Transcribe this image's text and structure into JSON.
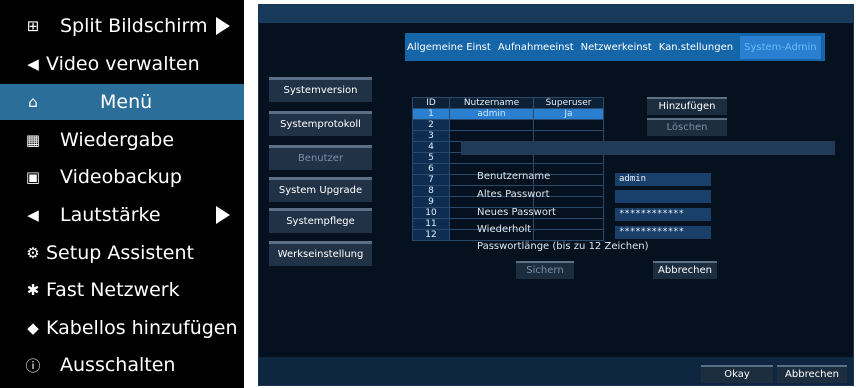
{
  "menu": {
    "items": [
      {
        "icon": "⊞",
        "label": "Split Bildschirm",
        "arrow": true
      },
      {
        "icon": "◀",
        "label": "Video verwalten",
        "arrow": false
      },
      {
        "icon": "⌂",
        "label": "Menü",
        "arrow": false,
        "selected": true
      },
      {
        "icon": "▦",
        "label": "Wiedergabe",
        "arrow": false
      },
      {
        "icon": "▣",
        "label": "Videobackup",
        "arrow": false
      },
      {
        "icon": "◀",
        "label": "Lautstärke",
        "arrow": true
      },
      {
        "icon": "⚙",
        "label": "Setup Assistent",
        "arrow": false
      },
      {
        "icon": "✱",
        "label": "Fast Netzwerk",
        "arrow": false
      },
      {
        "icon": "◆",
        "label": "Kabellos hinzufügen",
        "arrow": false
      },
      {
        "icon": "ⓘ",
        "label": "Ausschalten",
        "arrow": false
      }
    ]
  },
  "dialog": {
    "tabs": [
      "Allgemeine Einst",
      "Aufnahmeeinst",
      "Netzwerkeinst",
      "Kan.stellungen",
      "System-Admin"
    ],
    "active_tab": "System-Admin",
    "sidebar": [
      "Systemversion",
      "Systemprotokoll",
      "Benutzer",
      "System Upgrade",
      "Systempflege",
      "Werkseinstellung"
    ],
    "active_sidebar": "Benutzer",
    "table": {
      "headers": [
        "ID",
        "Nutzername",
        "Superuser"
      ],
      "rows": [
        {
          "id": "1",
          "name": "admin",
          "superuser": "Ja"
        },
        {
          "id": "2",
          "name": "",
          "superuser": ""
        },
        {
          "id": "3",
          "name": "",
          "superuser": ""
        },
        {
          "id": "4",
          "name": "",
          "superuser": ""
        },
        {
          "id": "5",
          "name": "",
          "superuser": ""
        },
        {
          "id": "6",
          "name": "",
          "superuser": ""
        },
        {
          "id": "7",
          "name": "",
          "superuser": ""
        },
        {
          "id": "8",
          "name": "",
          "superuser": ""
        },
        {
          "id": "9",
          "name": "",
          "superuser": ""
        },
        {
          "id": "10",
          "name": "",
          "superuser": ""
        },
        {
          "id": "11",
          "name": "",
          "superuser": ""
        },
        {
          "id": "12",
          "name": "",
          "superuser": ""
        }
      ]
    },
    "buttons": {
      "add": "Hinzufügen",
      "delete": "Löschen",
      "save": "Sichern",
      "cancel": "Abbrechen"
    },
    "form": {
      "username_label": "Benutzername",
      "username_value": "admin",
      "old_pw_label": "Altes Passwort",
      "old_pw_value": "",
      "new_pw_label": "Neues Passwort",
      "new_pw_value": "************",
      "repeat_label": "Wiederholt",
      "repeat_value": "************",
      "length_note": "Passwortlänge (bis zu 12 Zeichen)"
    },
    "footer": {
      "ok": "Okay",
      "cancel": "Abbrechen"
    }
  }
}
